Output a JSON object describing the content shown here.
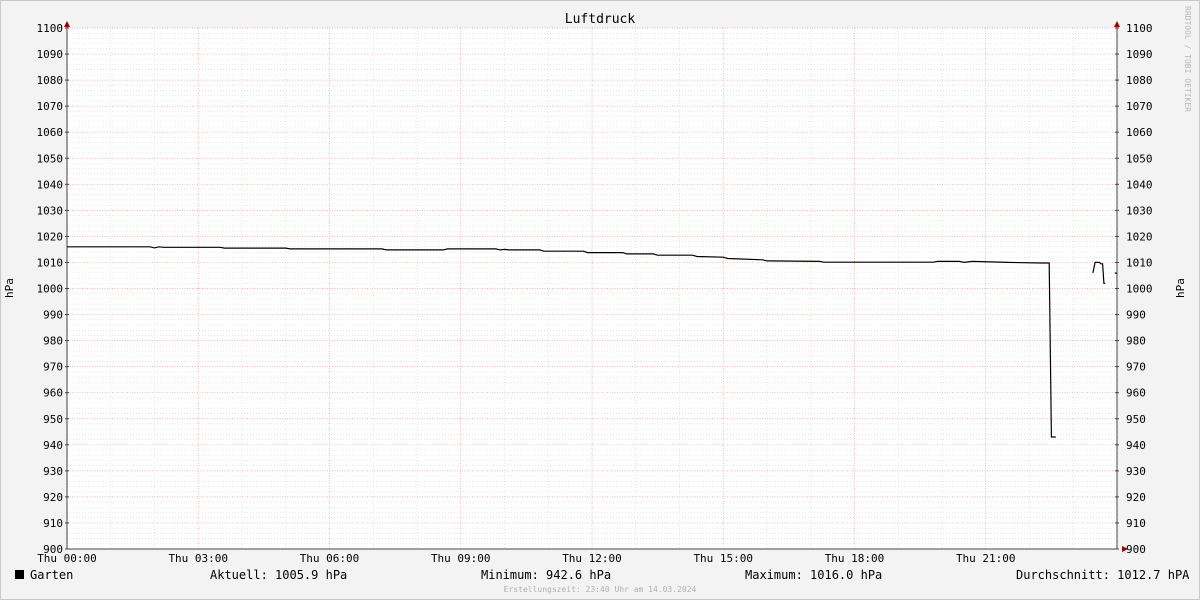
{
  "chart_data": {
    "type": "line",
    "title": "Luftdruck",
    "ylabel": "hPa",
    "ylim": [
      900,
      1100
    ],
    "y_ticks": [
      900,
      910,
      920,
      930,
      940,
      950,
      960,
      970,
      980,
      990,
      1000,
      1010,
      1020,
      1030,
      1040,
      1050,
      1060,
      1070,
      1080,
      1090,
      1100
    ],
    "x_ticks": [
      "Thu 00:00",
      "Thu 03:00",
      "Thu 06:00",
      "Thu 09:00",
      "Thu 12:00",
      "Thu 15:00",
      "Thu 18:00",
      "Thu 21:00"
    ],
    "xlim_hours": [
      0,
      24
    ],
    "grid": true,
    "series": [
      {
        "name": "Garten",
        "color": "#000000",
        "segments": [
          [
            [
              0,
              1016
            ],
            [
              1.9,
              1016
            ],
            [
              2.0,
              1015.6
            ],
            [
              2.1,
              1016
            ],
            [
              2.2,
              1015.8
            ],
            [
              3.5,
              1015.8
            ],
            [
              3.6,
              1015.5
            ],
            [
              5.0,
              1015.5
            ],
            [
              5.1,
              1015.2
            ],
            [
              7.2,
              1015.2
            ],
            [
              7.3,
              1014.8
            ],
            [
              8.6,
              1014.8
            ],
            [
              8.7,
              1015.2
            ],
            [
              9.8,
              1015.2
            ],
            [
              9.9,
              1014.8
            ],
            [
              10.0,
              1015.0
            ],
            [
              10.1,
              1014.8
            ],
            [
              10.8,
              1014.8
            ],
            [
              10.9,
              1014.3
            ],
            [
              11.8,
              1014.3
            ],
            [
              11.9,
              1013.8
            ],
            [
              12.7,
              1013.8
            ],
            [
              12.8,
              1013.3
            ],
            [
              13.4,
              1013.3
            ],
            [
              13.5,
              1012.8
            ],
            [
              14.3,
              1012.8
            ],
            [
              14.4,
              1012.3
            ],
            [
              15.0,
              1012.0
            ],
            [
              15.1,
              1011.5
            ],
            [
              15.9,
              1011.0
            ],
            [
              16.0,
              1010.6
            ],
            [
              17.2,
              1010.4
            ],
            [
              17.3,
              1010.1
            ],
            [
              19.8,
              1010.1
            ],
            [
              19.9,
              1010.4
            ],
            [
              20.4,
              1010.4
            ],
            [
              20.5,
              1010.0
            ],
            [
              20.7,
              1010.4
            ],
            [
              21.5,
              1010.0
            ],
            [
              22.3,
              1009.8
            ],
            [
              22.45,
              1009.8
            ],
            [
              22.5,
              943.0
            ],
            [
              22.6,
              943.0
            ]
          ],
          [
            [
              23.45,
              1006.0
            ],
            [
              23.5,
              1010.0
            ],
            [
              23.6,
              1010.0
            ],
            [
              23.63,
              1009.5
            ],
            [
              23.67,
              1009.5
            ],
            [
              23.7,
              1002.0
            ],
            [
              23.73,
              1002.0
            ]
          ],
          [
            [
              23.95,
              1005.9
            ],
            [
              24.0,
              1005.9
            ]
          ]
        ]
      }
    ]
  },
  "legend": {
    "series_label": "Garten",
    "aktuell": "Aktuell: 1005.9 hPa",
    "minimum": "Minimum: 942.6 hPa",
    "maximum": "Maximum: 1016.0 hPa",
    "durchschnitt": "Durchschnitt: 1012.7 hPA"
  },
  "footer_note": "Erstellungszeit: 23:40 Uhr am 14.03.2024",
  "watermark": "RRDTOOL / TOBI OETIKER"
}
